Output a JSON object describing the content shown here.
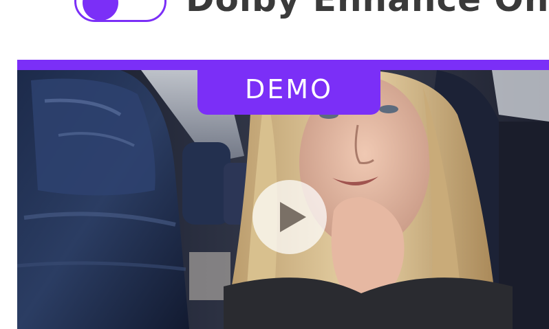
{
  "toggle": {
    "label": "Dolby Enhance On",
    "state": "on",
    "accent_color": "#7b2ff7"
  },
  "video": {
    "badge_label": "DEMO",
    "play_icon": "play-icon",
    "accent_color": "#7b2ff7"
  }
}
